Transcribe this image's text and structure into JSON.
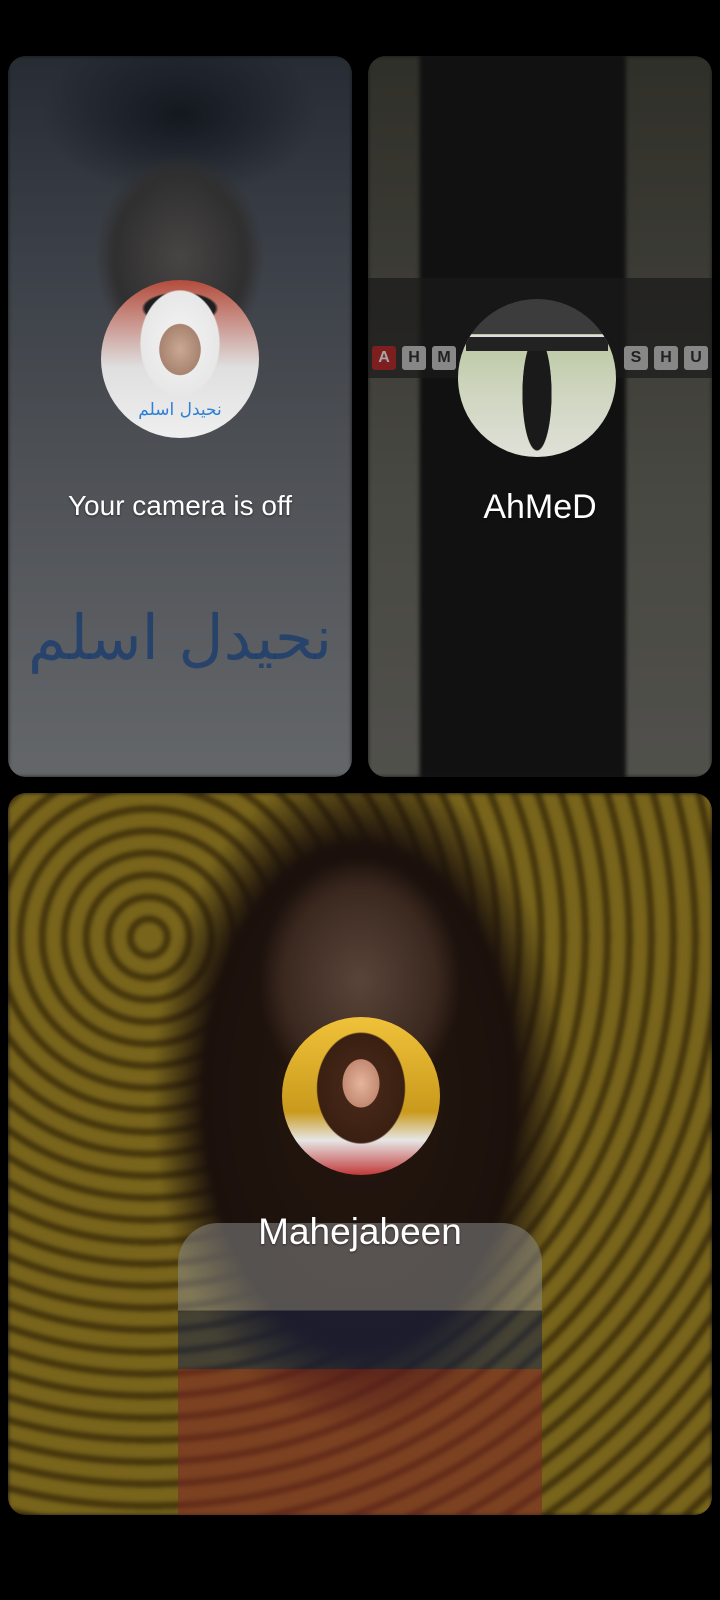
{
  "participants": [
    {
      "id": "self",
      "label": "Your camera is off",
      "avatar_text": "نحیدل اسلم",
      "background_text": "نحیدل اسلم"
    },
    {
      "id": "ahmed",
      "label": "AhMeD",
      "banner_letters": [
        "A",
        "H",
        "M",
        "S",
        "H",
        "U"
      ]
    },
    {
      "id": "mahejabeen",
      "label": "Mahejabeen"
    }
  ],
  "icons": {
    "self_avatar": "avatar-photo-icon",
    "ahmed_avatar": "avatar-photo-icon",
    "mahejabeen_avatar": "avatar-photo-icon"
  }
}
